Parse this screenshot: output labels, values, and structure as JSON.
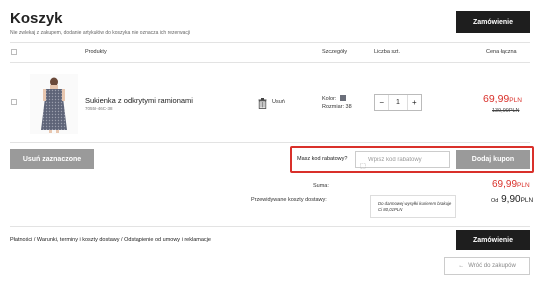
{
  "header": {
    "title": "Koszyk",
    "subtitle": "Nie zwlekaj z zakupem, dodanie artykułów do koszyka nie oznacza ich rezerwacji",
    "order_button": "Zamówienie"
  },
  "table": {
    "headers": {
      "product": "Produkty",
      "details": "Szczegóły",
      "quantity": "Liczba szt.",
      "total": "Cena łączna"
    }
  },
  "item": {
    "name": "Sukienka z odkrytymi ramionami",
    "sku": "7055I-46C-38",
    "remove_label": "Usuń",
    "color_label": "Kolor:",
    "size_label": "Rozmiar: 38",
    "qty_minus": "−",
    "qty": "1",
    "qty_plus": "+",
    "price": "69,99",
    "price_currency": "PLN",
    "old_price": "139,99PLN"
  },
  "actions": {
    "remove_selected": "Usuń zaznaczone",
    "coupon_question": "Masz kod rabatowy?",
    "coupon_placeholder": "Wpisz kod rabatowy",
    "coupon_button": "Dodaj kupon"
  },
  "summary": {
    "sum_label": "Suma:",
    "sum_value": "69,99",
    "sum_currency": "PLN",
    "shipping_label": "Przewidywane koszty dostawy:",
    "shipping_prefix": "Od",
    "shipping_value": "9,90",
    "shipping_currency": "PLN",
    "free_shipping_note": "Do darmowej wysyłki kurierem brakuje Ci 80,01PLN"
  },
  "footer": {
    "links": "Płatności / Warunki, terminy i koszty dostawy / Odstąpienie od umowy i reklamacje",
    "order_button": "Zamówienie",
    "back_button": "Wróć do zakupów",
    "back_arrow": "←"
  },
  "colors": {
    "accent_red": "#d9302a",
    "dark_button": "#1e1e1e",
    "grey_button": "#9a9a9a"
  }
}
